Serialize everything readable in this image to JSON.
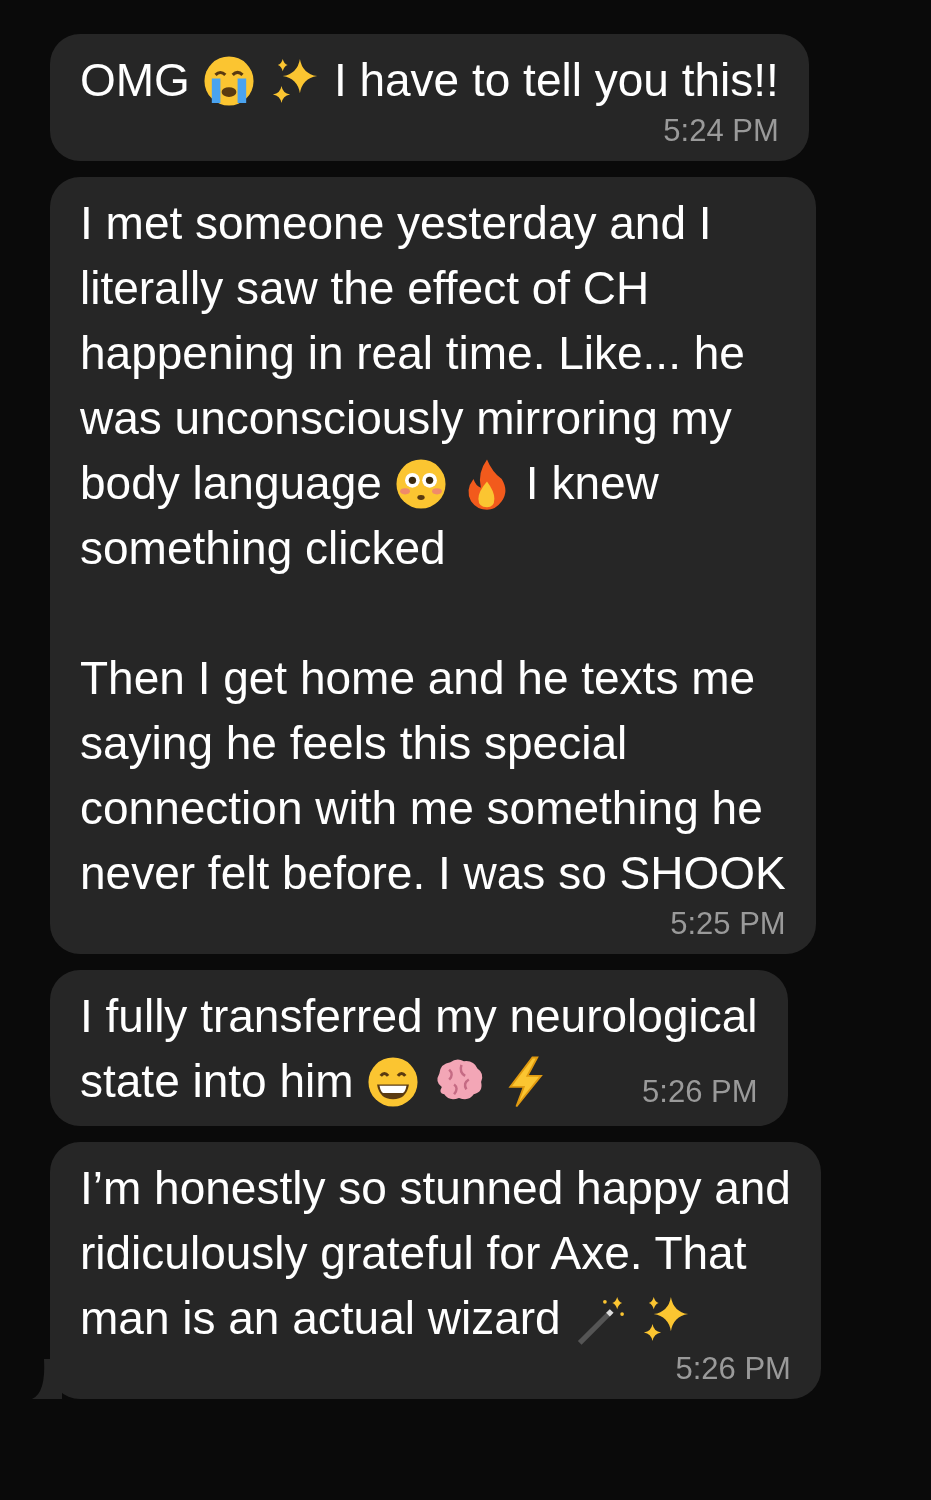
{
  "messages": [
    {
      "tail": false,
      "time_inline": false,
      "time": "5:24 PM",
      "paragraphs": [
        [
          [
            {
              "kind": "text",
              "text": "OMG"
            },
            {
              "kind": "crying"
            },
            {
              "kind": "sparkles"
            },
            {
              "kind": "text",
              "text": "I have to tell you this!!"
            }
          ]
        ]
      ]
    },
    {
      "tail": false,
      "time_inline": false,
      "time": "5:25 PM",
      "paragraphs": [
        [
          [
            {
              "kind": "text",
              "text": "I met someone yesterday and I"
            }
          ],
          [
            {
              "kind": "text",
              "text": "literally saw the effect of CH"
            }
          ],
          [
            {
              "kind": "text",
              "text": "happening in real time. Like... he"
            }
          ],
          [
            {
              "kind": "text",
              "text": "was unconsciously mirroring my"
            }
          ],
          [
            {
              "kind": "text",
              "text": "body language"
            },
            {
              "kind": "flushed"
            },
            {
              "kind": "fire"
            },
            {
              "kind": "text",
              "text": "I knew"
            }
          ],
          [
            {
              "kind": "text",
              "text": "something clicked"
            }
          ]
        ],
        [
          [
            {
              "kind": "text",
              "text": "Then I get home and he texts me"
            }
          ],
          [
            {
              "kind": "text",
              "text": "saying he feels this special"
            }
          ],
          [
            {
              "kind": "text",
              "text": "connection with me something he"
            }
          ],
          [
            {
              "kind": "text",
              "text": "never felt before. I was so SHOOK"
            }
          ]
        ]
      ]
    },
    {
      "tail": false,
      "time_inline": true,
      "time": "5:26 PM",
      "paragraphs": [
        [
          [
            {
              "kind": "text",
              "text": "I fully transferred my neurological"
            }
          ],
          [
            {
              "kind": "text",
              "text": "state into him"
            },
            {
              "kind": "grin"
            },
            {
              "kind": "brain"
            },
            {
              "kind": "bolt"
            }
          ]
        ]
      ]
    },
    {
      "tail": true,
      "time_inline": false,
      "time": "5:26 PM",
      "paragraphs": [
        [
          [
            {
              "kind": "text",
              "text": "I’m honestly so stunned happy and"
            }
          ],
          [
            {
              "kind": "text",
              "text": "ridiculously grateful for Axe. That"
            }
          ],
          [
            {
              "kind": "text",
              "text": "man is an actual wizard"
            },
            {
              "kind": "wand"
            },
            {
              "kind": "sparkles"
            }
          ]
        ]
      ]
    }
  ]
}
